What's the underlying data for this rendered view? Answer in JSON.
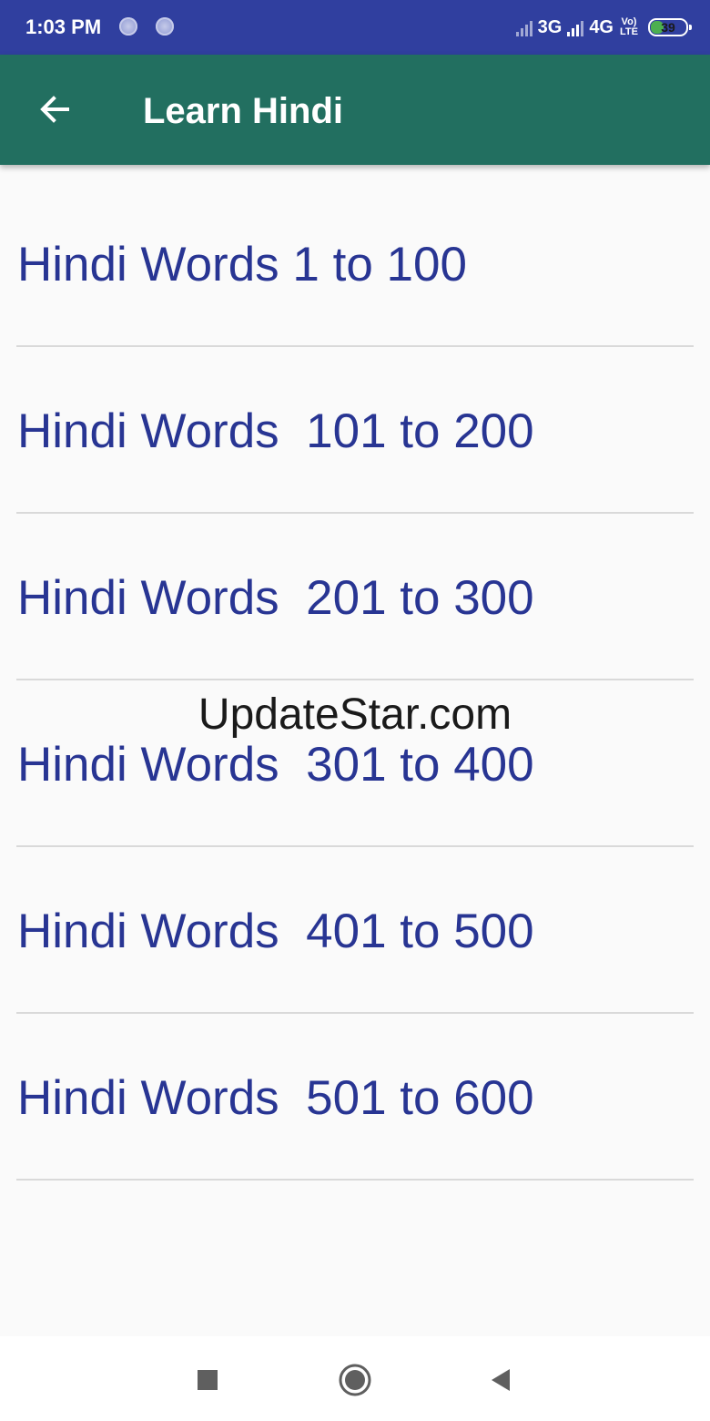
{
  "status_bar": {
    "time": "1:03 PM",
    "network_1": "3G",
    "network_2": "4G",
    "volte_top": "Vo)",
    "volte_bottom": "LTE",
    "battery_level": "39",
    "battery_color": "#4caf50",
    "background": "#303f9f",
    "icons": [
      "notification-dot-icon",
      "notification-dot-icon",
      "signal-icon",
      "signal-icon",
      "battery-icon"
    ]
  },
  "app_bar": {
    "title": "Learn Hindi",
    "back_icon": "arrow-left-icon",
    "background": "#226f60"
  },
  "list": {
    "text_color": "#283593",
    "items": [
      {
        "label": "Hindi Words 1 to 100"
      },
      {
        "label": "Hindi Words  101 to 200"
      },
      {
        "label": "Hindi Words  201 to 300"
      },
      {
        "label": "Hindi Words  301 to 400"
      },
      {
        "label": "Hindi Words  401 to 500"
      },
      {
        "label": "Hindi Words  501 to 600"
      }
    ]
  },
  "watermark": {
    "text": "UpdateStar.com"
  },
  "nav_bar": {
    "icons": [
      "square-recents-icon",
      "circle-home-icon",
      "triangle-back-icon"
    ]
  }
}
